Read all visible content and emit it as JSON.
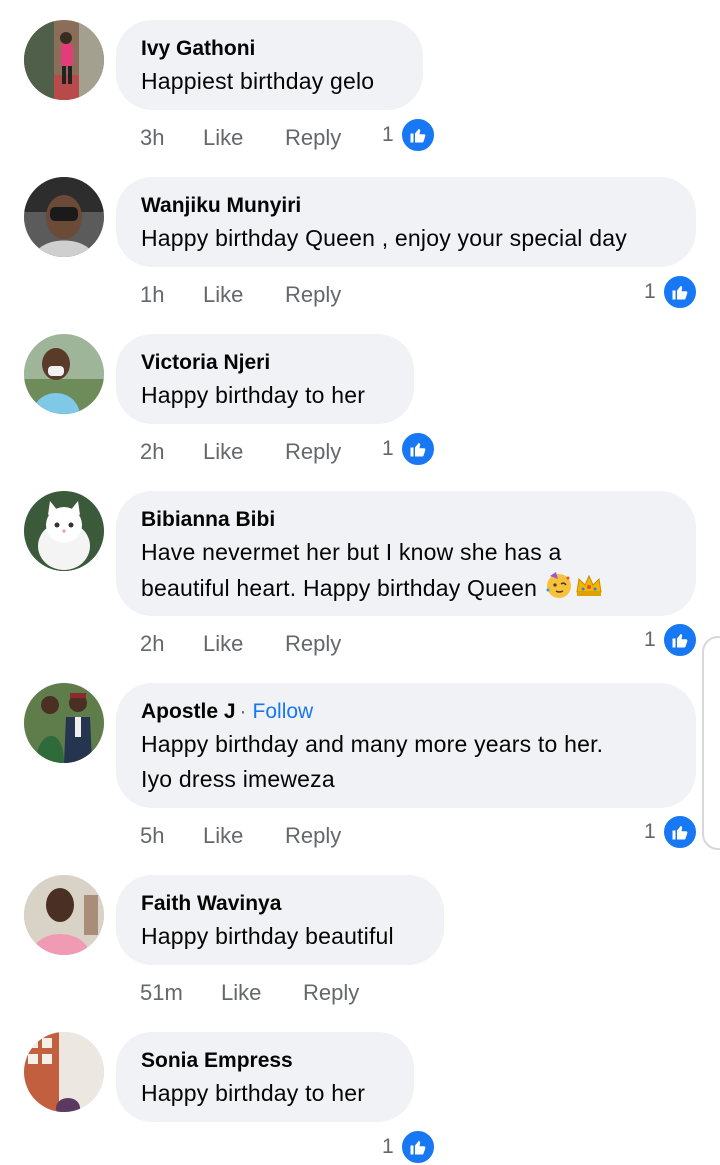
{
  "comments": [
    {
      "name": "Ivy Gathoni",
      "text": "Happiest birthday gelo",
      "time": "3h",
      "like_label": "Like",
      "reply_label": "Reply",
      "reactions": "1",
      "avatar_icon": "person-photo"
    },
    {
      "name": "Wanjiku Munyiri",
      "text": "Happy birthday Queen , enjoy your special day",
      "time": "1h",
      "like_label": "Like",
      "reply_label": "Reply",
      "reactions": "1",
      "avatar_icon": "person-photo"
    },
    {
      "name": "Victoria Njeri",
      "text": "Happy birthday to her",
      "time": "2h",
      "like_label": "Like",
      "reply_label": "Reply",
      "reactions": "1",
      "avatar_icon": "person-photo"
    },
    {
      "name": "Bibianna Bibi",
      "text_line1": "Have nevermet her  but I know she has a",
      "text_line2": "beautiful heart. Happy birthday Queen",
      "emojis": [
        "partying-face-emoji",
        "crown-emoji"
      ],
      "time": "2h",
      "like_label": "Like",
      "reply_label": "Reply",
      "reactions": "1",
      "avatar_icon": "white-cat-photo"
    },
    {
      "name": "Apostle J",
      "separator": "·",
      "follow_label": "Follow",
      "text_line1": "Happy birthday and many more years to her.",
      "text_line2": "Iyo dress imeweza",
      "time": "5h",
      "like_label": "Like",
      "reply_label": "Reply",
      "reactions": "1",
      "avatar_icon": "couple-photo"
    },
    {
      "name": "Faith Wavinya",
      "text": "Happy birthday beautiful",
      "time": "51m",
      "like_label": "Like",
      "reply_label": "Reply",
      "avatar_icon": "person-photo"
    },
    {
      "name": "Sonia Empress",
      "text": "Happy birthday to her",
      "reactions": "1",
      "avatar_icon": "person-photo"
    }
  ],
  "colors": {
    "bubble": "#f0f2f5",
    "meta": "#65676b",
    "accent": "#1877f2",
    "text": "#050505"
  }
}
